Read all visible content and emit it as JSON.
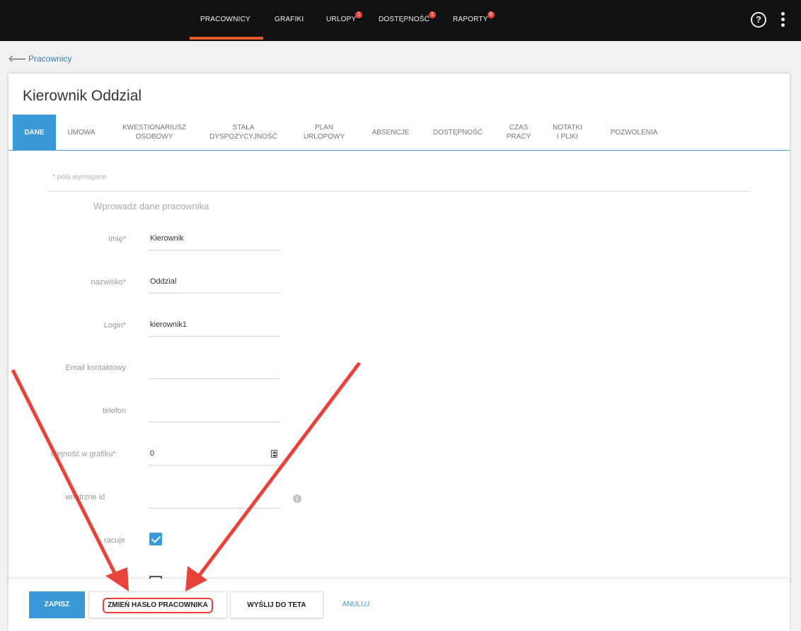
{
  "topnav": {
    "items": [
      {
        "label": "PRACOWNICY",
        "badge": ""
      },
      {
        "label": "GRAFIKI",
        "badge": ""
      },
      {
        "label": "URLOPY",
        "badge": "1"
      },
      {
        "label": "DOSTĘPNOŚĆ",
        "badge": "1"
      },
      {
        "label": "RAPORTY",
        "badge": "0"
      }
    ],
    "active_item": "PRACOWNICY",
    "help_glyph": "?",
    "accent_color": "#e55b2a"
  },
  "breadcrumb": {
    "label": "Pracownicy"
  },
  "page": {
    "title": "Kierownik Oddzial"
  },
  "tabs": [
    {
      "label": "DANE",
      "active": true
    },
    {
      "label": "UMOWA"
    },
    {
      "label": "KWESTIONARIUSZ OSOBOWY"
    },
    {
      "label": "STAŁA DYSPOZYCYJNOŚĆ"
    },
    {
      "label": "PLAN URLOPOWY"
    },
    {
      "label": "ABSENCJE"
    },
    {
      "label": "DOSTĘPNOŚĆ"
    },
    {
      "label": "CZAS PRACY"
    },
    {
      "label": "NOTATKI I PLIKI"
    },
    {
      "label": "POZWOLENIA"
    }
  ],
  "form": {
    "required_note": "* pola wymagane",
    "section_heading": "Wprowadź dane pracownika",
    "fields": [
      {
        "label": "imię*",
        "value": "Kierownik"
      },
      {
        "label": "nazwisko*",
        "value": "Oddzial"
      },
      {
        "label": "Login*",
        "value": "kierownik1"
      },
      {
        "label": "Email kontaktowy",
        "value": ""
      },
      {
        "label": "telefon",
        "value": ""
      },
      {
        "label": "olejność w grafiku*",
        "value": "0"
      },
      {
        "label": "wnętrzne id",
        "value": ""
      }
    ],
    "checkbox_label": "racuje",
    "checkbox_checked": true,
    "info_glyph": "i"
  },
  "footer": {
    "save_label": "ZAPISZ",
    "change_password_label": "ZMIEŃ HASŁO PRACOWNIKA",
    "send_label": "WYŚLIJ DO TETA",
    "cancel_label": "ANULUJ"
  },
  "colors": {
    "primary": "#3a9ad9",
    "annotation": "#e8433a",
    "nav_bg": "#111111"
  }
}
